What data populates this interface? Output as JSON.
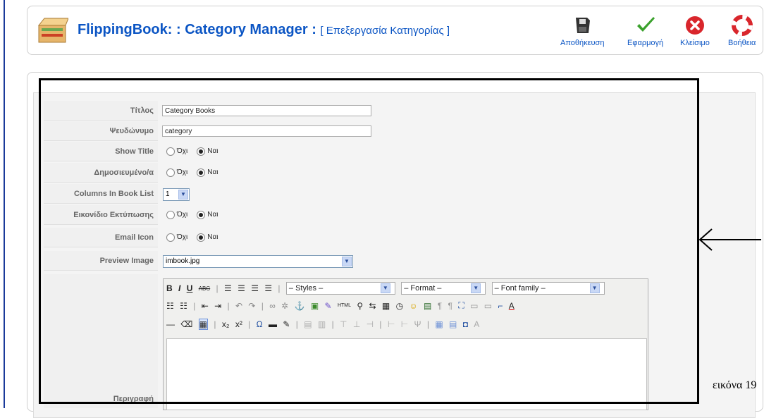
{
  "header": {
    "title": "FlippingBook: : Category Manager :",
    "subtitle": "[ Επεξεργασία Κατηγορίας ]",
    "buttons": [
      {
        "label": "Αποθήκευση",
        "icon": "floppy-disk-icon"
      },
      {
        "label": "Εφαρμογή",
        "icon": "checkmark-icon"
      },
      {
        "label": "Κλείσιμο",
        "icon": "close-icon"
      },
      {
        "label": "Βοήθεια",
        "icon": "lifebuoy-icon"
      }
    ]
  },
  "form": {
    "title_label": "Τίτλος",
    "title_value": "Category Books",
    "alias_label": "Ψευδώνυμο",
    "alias_value": "category",
    "show_title_label": "Show Title",
    "published_label": "Δημοσιευμένο/α",
    "columns_label": "Columns In Book List",
    "columns_value": "1",
    "print_icon_label": "Εικονίδιο Εκτύπωσης",
    "email_icon_label": "Email Icon",
    "preview_label": "Preview Image",
    "preview_value": "imbook.jpg",
    "description_label": "Περιγραφή",
    "radio_no": "Όχι",
    "radio_yes": "Ναι"
  },
  "editor": {
    "styles": "– Styles –",
    "format": "– Format –",
    "font_family": "– Font family –"
  },
  "caption": "εικόνα 19",
  "colors": {
    "accent": "#0b55c4",
    "label_bg": "#f0f0f0"
  }
}
